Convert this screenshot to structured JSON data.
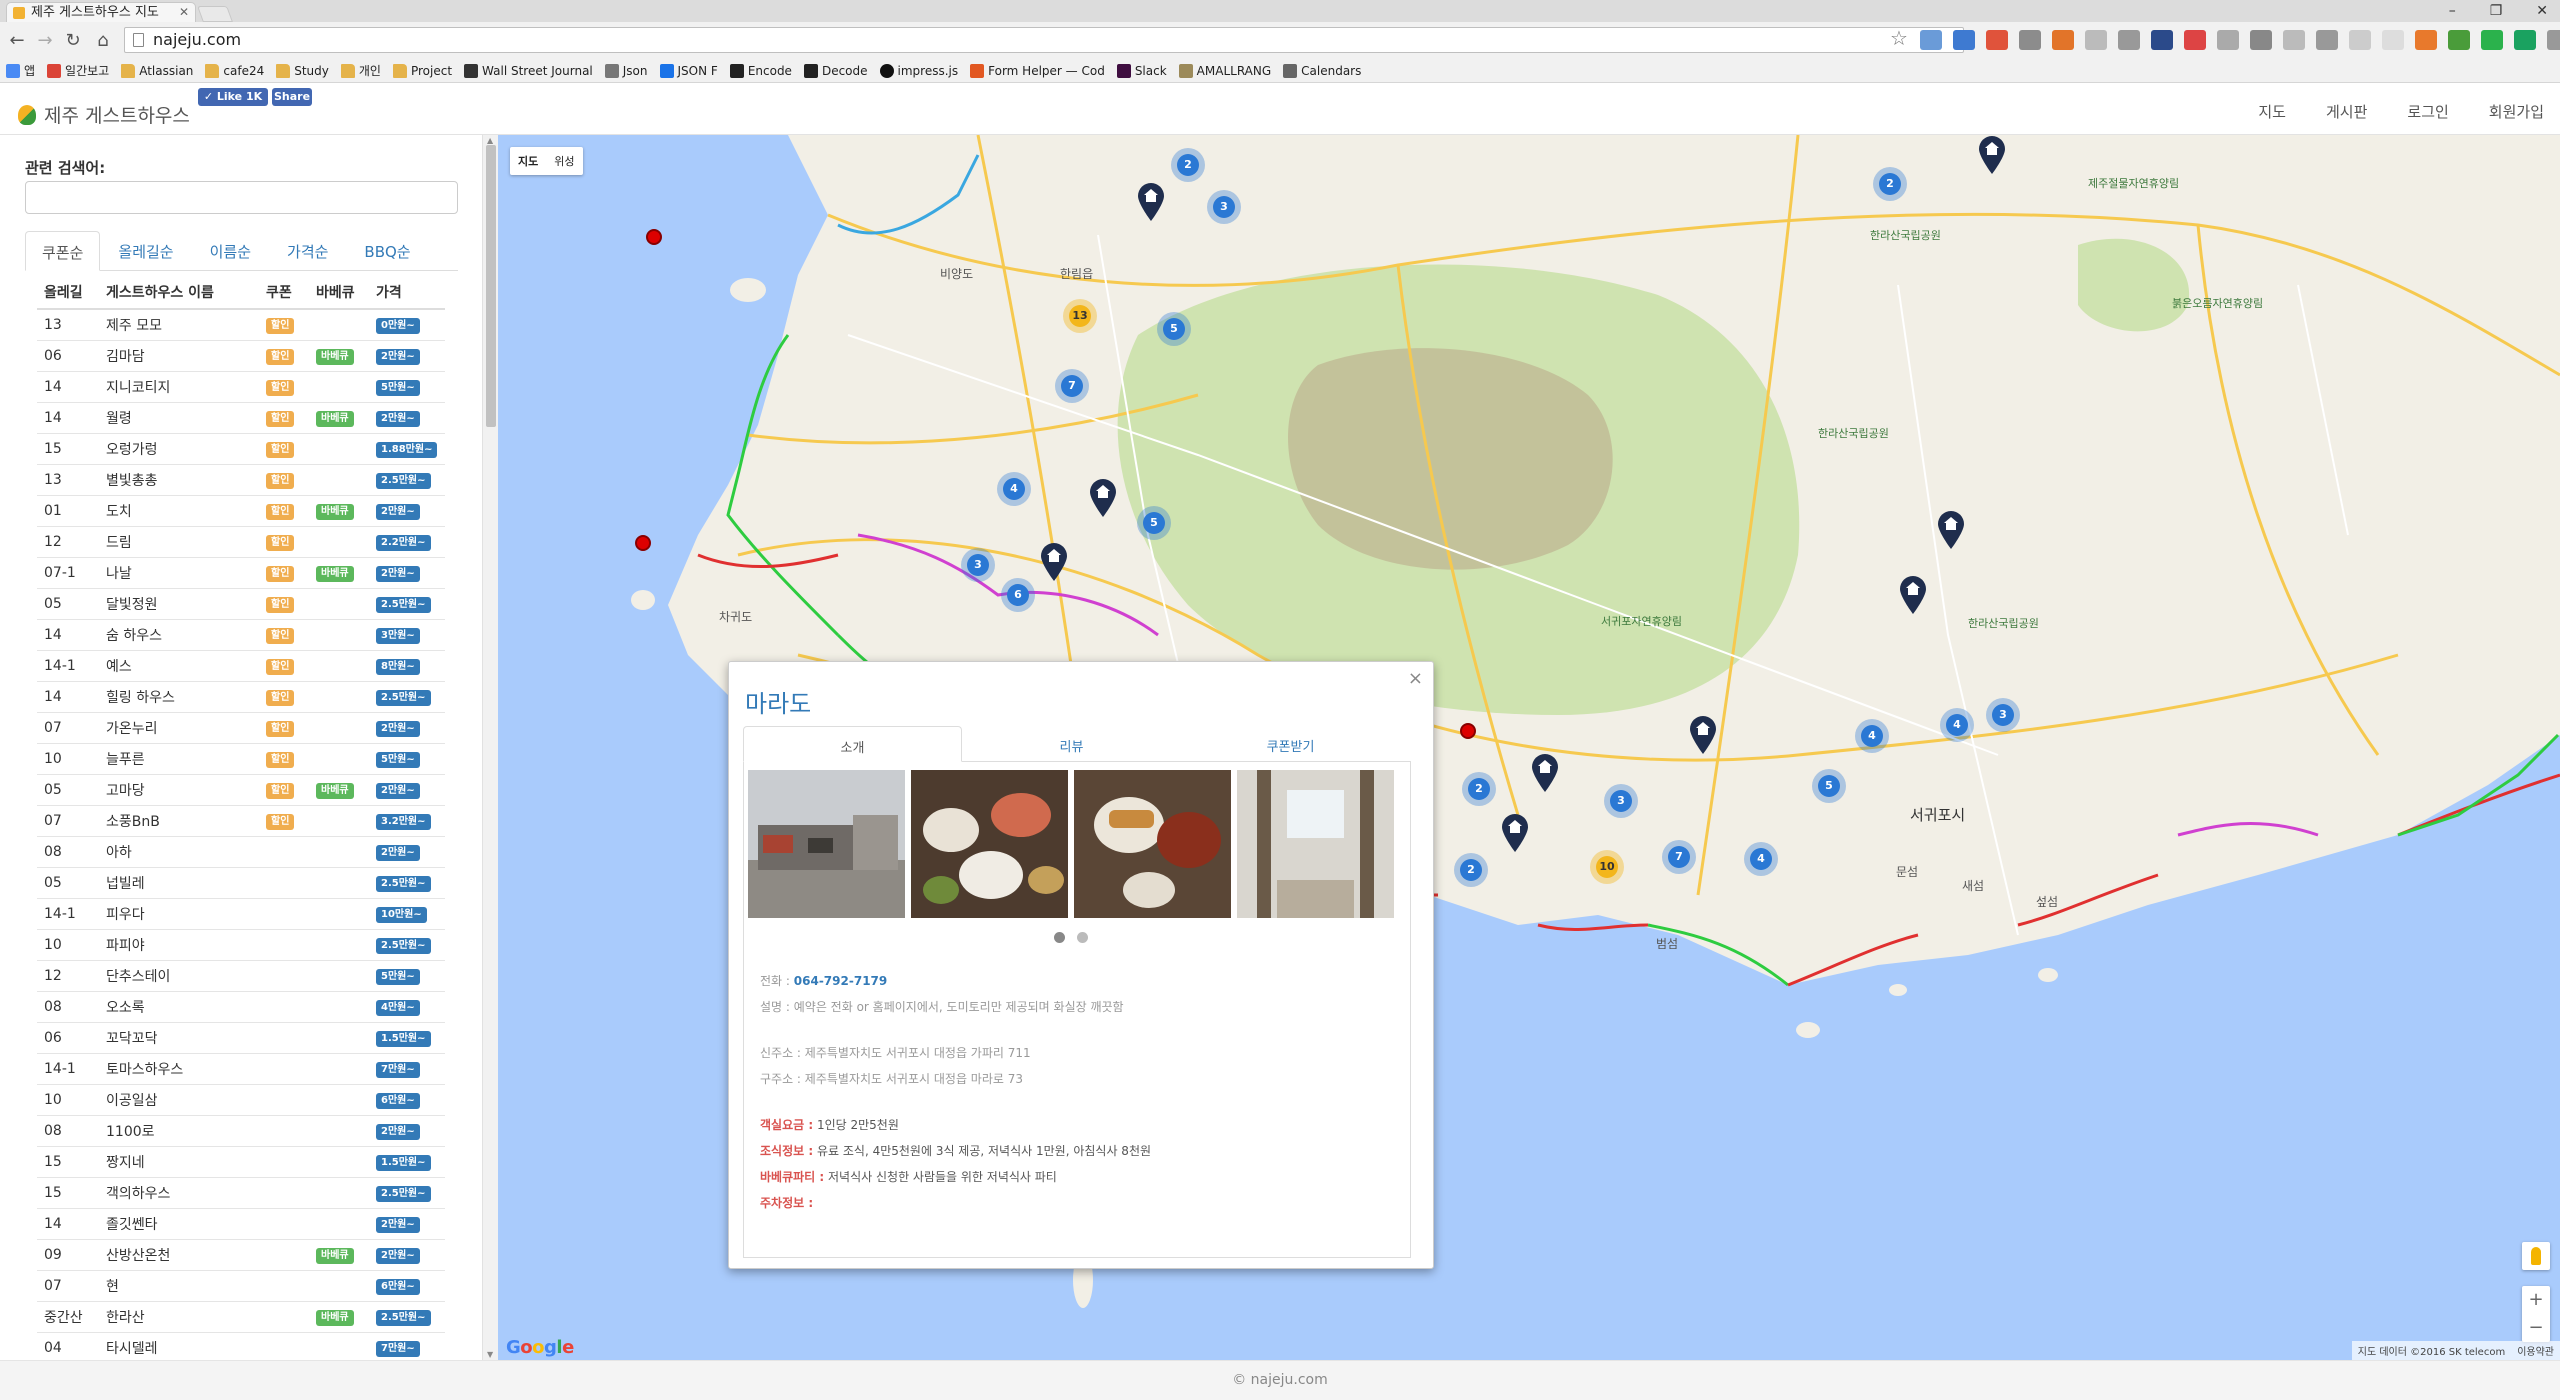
{
  "browser": {
    "tab_title": "제주 게스트하우스 지도",
    "url": "najeju.com",
    "bookmarks": [
      "앱",
      "일간보고",
      "Atlassian",
      "cafe24",
      "Study",
      "개인",
      "Project",
      "Wall Street Journal",
      "Json",
      "JSON F",
      "Encode",
      "Decode",
      "impress.js",
      "Form Helper — Cod",
      "Slack",
      "AMALLRANG",
      "Calendars"
    ]
  },
  "header": {
    "logo": "제주 게스트하우스",
    "fb_like": "✓ Like 1K",
    "fb_share": "Share",
    "nav": [
      "지도",
      "게시판",
      "로그인",
      "회원가입"
    ]
  },
  "sidebar": {
    "search_label": "관련 검색어:",
    "search_value": "",
    "tabs": [
      "쿠폰순",
      "올레길순",
      "이름순",
      "가격순",
      "BBQ순"
    ],
    "columns": [
      "올레길",
      "게스트하우스 이름",
      "쿠폰",
      "바베큐",
      "가격"
    ],
    "rows": [
      {
        "route": "13",
        "name": "제주 모모",
        "coupon": "할인",
        "bbq": "",
        "price": "0만원~"
      },
      {
        "route": "06",
        "name": "김마담",
        "coupon": "할인",
        "bbq": "바베큐",
        "price": "2만원~"
      },
      {
        "route": "14",
        "name": "지니코티지",
        "coupon": "할인",
        "bbq": "",
        "price": "5만원~"
      },
      {
        "route": "14",
        "name": "월령",
        "coupon": "할인",
        "bbq": "바베큐",
        "price": "2만원~"
      },
      {
        "route": "15",
        "name": "오렁가렁",
        "coupon": "할인",
        "bbq": "",
        "price": "1.88만원~"
      },
      {
        "route": "13",
        "name": "별빛총총",
        "coupon": "할인",
        "bbq": "",
        "price": "2.5만원~"
      },
      {
        "route": "01",
        "name": "도치",
        "coupon": "할인",
        "bbq": "바베큐",
        "price": "2만원~"
      },
      {
        "route": "12",
        "name": "드림",
        "coupon": "할인",
        "bbq": "",
        "price": "2.2만원~"
      },
      {
        "route": "07-1",
        "name": "나날",
        "coupon": "할인",
        "bbq": "바베큐",
        "price": "2만원~"
      },
      {
        "route": "05",
        "name": "달빛정원",
        "coupon": "할인",
        "bbq": "",
        "price": "2.5만원~"
      },
      {
        "route": "14",
        "name": "숨 하우스",
        "coupon": "할인",
        "bbq": "",
        "price": "3만원~"
      },
      {
        "route": "14-1",
        "name": "예스",
        "coupon": "할인",
        "bbq": "",
        "price": "8만원~"
      },
      {
        "route": "14",
        "name": "힐링 하우스",
        "coupon": "할인",
        "bbq": "",
        "price": "2.5만원~"
      },
      {
        "route": "07",
        "name": "가온누리",
        "coupon": "할인",
        "bbq": "",
        "price": "2만원~"
      },
      {
        "route": "10",
        "name": "늘푸른",
        "coupon": "할인",
        "bbq": "",
        "price": "5만원~"
      },
      {
        "route": "05",
        "name": "고마당",
        "coupon": "할인",
        "bbq": "바베큐",
        "price": "2만원~"
      },
      {
        "route": "07",
        "name": "소풍BnB",
        "coupon": "할인",
        "bbq": "",
        "price": "3.2만원~"
      },
      {
        "route": "08",
        "name": "아하",
        "coupon": "",
        "bbq": "",
        "price": "2만원~"
      },
      {
        "route": "05",
        "name": "넙빌레",
        "coupon": "",
        "bbq": "",
        "price": "2.5만원~"
      },
      {
        "route": "14-1",
        "name": "피우다",
        "coupon": "",
        "bbq": "",
        "price": "10만원~"
      },
      {
        "route": "10",
        "name": "파피야",
        "coupon": "",
        "bbq": "",
        "price": "2.5만원~"
      },
      {
        "route": "12",
        "name": "단추스테이",
        "coupon": "",
        "bbq": "",
        "price": "5만원~"
      },
      {
        "route": "08",
        "name": "오소록",
        "coupon": "",
        "bbq": "",
        "price": "4만원~"
      },
      {
        "route": "06",
        "name": "꼬닥꼬닥",
        "coupon": "",
        "bbq": "",
        "price": "1.5만원~"
      },
      {
        "route": "14-1",
        "name": "토마스하우스",
        "coupon": "",
        "bbq": "",
        "price": "7만원~"
      },
      {
        "route": "10",
        "name": "이공일삼",
        "coupon": "",
        "bbq": "",
        "price": "6만원~"
      },
      {
        "route": "08",
        "name": "1100로",
        "coupon": "",
        "bbq": "",
        "price": "2만원~"
      },
      {
        "route": "15",
        "name": "짱지네",
        "coupon": "",
        "bbq": "",
        "price": "1.5만원~"
      },
      {
        "route": "15",
        "name": "객의하우스",
        "coupon": "",
        "bbq": "",
        "price": "2.5만원~"
      },
      {
        "route": "14",
        "name": "졸깃쎈타",
        "coupon": "",
        "bbq": "",
        "price": "2만원~"
      },
      {
        "route": "09",
        "name": "산방산온천",
        "coupon": "",
        "bbq": "바베큐",
        "price": "2만원~"
      },
      {
        "route": "07",
        "name": "현",
        "coupon": "",
        "bbq": "",
        "price": "6만원~"
      },
      {
        "route": "중간산",
        "name": "한라산",
        "coupon": "",
        "bbq": "바베큐",
        "price": "2.5만원~"
      },
      {
        "route": "04",
        "name": "타시델레",
        "coupon": "",
        "bbq": "",
        "price": "7만원~"
      }
    ]
  },
  "map": {
    "type_buttons": [
      "지도",
      "위성"
    ],
    "google": "Google",
    "attribution": "지도 데이터 ©2016 SK telecom",
    "terms": "이용약관",
    "labels": [
      {
        "text": "비양도",
        "kind": "normal"
      },
      {
        "text": "한림읍",
        "kind": "normal"
      },
      {
        "text": "차귀도",
        "kind": "normal"
      },
      {
        "text": "서귀포시",
        "kind": "big"
      },
      {
        "text": "범섬",
        "kind": "normal"
      },
      {
        "text": "문섬",
        "kind": "normal"
      },
      {
        "text": "섶섬",
        "kind": "normal"
      },
      {
        "text": "새섬",
        "kind": "normal"
      },
      {
        "text": "한라산국립공원",
        "kind": "green"
      },
      {
        "text": "한라산국립공원",
        "kind": "green"
      },
      {
        "text": "한라산국립공원",
        "kind": "green"
      },
      {
        "text": "제주절물자연휴양림",
        "kind": "green"
      },
      {
        "text": "붉은오름자연휴양림",
        "kind": "green"
      },
      {
        "text": "서귀포자연휴양림",
        "kind": "green"
      }
    ],
    "clusters": [
      "2",
      "3",
      "13",
      "5",
      "7",
      "4",
      "5",
      "3",
      "6",
      "2",
      "3",
      "2",
      "2",
      "3",
      "10",
      "7",
      "4",
      "5",
      "4",
      "4",
      "3"
    ]
  },
  "modal": {
    "title": "마라도",
    "tabs": [
      "소개",
      "리뷰",
      "쿠폰받기"
    ],
    "tel_label": "전화 :",
    "tel": "064-792-7179",
    "desc": "설명 : 예약은 전화 or 홈페이지에서, 도미토리만 제공되며 화실장 깨끗함",
    "new_addr": "신주소 : 제주특별자치도 서귀포시 대정읍 가파리 711",
    "old_addr": "구주소 : 제주특별자치도 서귀포시 대정읍 마라로 73",
    "room_label": "객실요금 :",
    "room": "1인당 2만5천원",
    "breakfast_label": "조식정보 :",
    "breakfast": "유료 조식, 4만5천원에 3식 제공, 저녁식사 1만원, 아침식사 8천원",
    "bbq_label": "바베큐파티 :",
    "bbq": "저녁식사 신청한 사람들을 위한 저녁식사 파티",
    "parking_label": "주차정보 :",
    "parking": ""
  },
  "footer": "© najeju.com",
  "colors": {
    "primary": "#337ab7",
    "coupon": "#f0ad4e",
    "bbq": "#5cb85c",
    "sea": "#a9cbfc",
    "land": "#f2efe6"
  }
}
